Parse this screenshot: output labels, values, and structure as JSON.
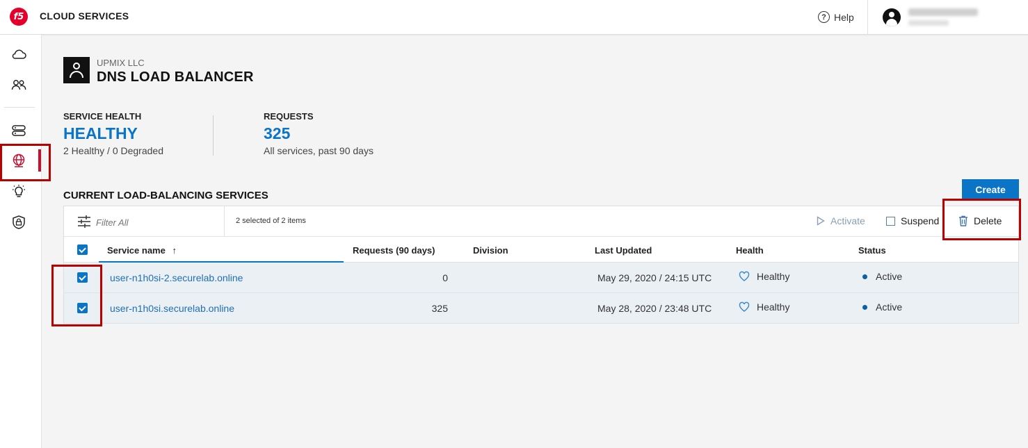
{
  "app": {
    "logo_text": "f5",
    "title": "CLOUD SERVICES"
  },
  "header": {
    "help_label": "Help"
  },
  "sidebar": {
    "items": [
      {
        "name": "cloud-icon"
      },
      {
        "name": "users-icon"
      },
      {
        "name": "servers-icon"
      },
      {
        "name": "globe-icon",
        "active": true
      },
      {
        "name": "lightbulb-icon"
      },
      {
        "name": "security-icon"
      }
    ]
  },
  "page": {
    "org": "UPMIX LLC",
    "title": "DNS LOAD BALANCER"
  },
  "stats": {
    "health": {
      "label": "SERVICE HEALTH",
      "value": "HEALTHY",
      "sub": "2 Healthy / 0 Degraded"
    },
    "requests": {
      "label": "REQUESTS",
      "value": "325",
      "sub": "All services, past 90 days"
    }
  },
  "section": {
    "title": "CURRENT LOAD-BALANCING SERVICES",
    "create_label": "Create"
  },
  "toolbar": {
    "filter_placeholder": "Filter All",
    "selected_info": "2 selected of 2 items",
    "activate_label": "Activate",
    "suspend_label": "Suspend",
    "delete_label": "Delete"
  },
  "table": {
    "columns": {
      "service_name": "Service name",
      "sort_arrow": "↑",
      "requests": "Requests (90 days)",
      "division": "Division",
      "last_updated": "Last Updated",
      "health": "Health",
      "status": "Status"
    },
    "rows": [
      {
        "service_name": "user-n1h0si-2.securelab.online",
        "requests": "0",
        "division": "",
        "last_updated": "May 29, 2020 / 24:15 UTC",
        "health": "Healthy",
        "status": "Active",
        "checked": true
      },
      {
        "service_name": "user-n1h0si.securelab.online",
        "requests": "325",
        "division": "",
        "last_updated": "May 28, 2020 / 23:48 UTC",
        "health": "Healthy",
        "status": "Active",
        "checked": true
      }
    ]
  },
  "colors": {
    "accent": "#0a74c7",
    "brand": "#e4002b",
    "highlight": "#b00000"
  }
}
